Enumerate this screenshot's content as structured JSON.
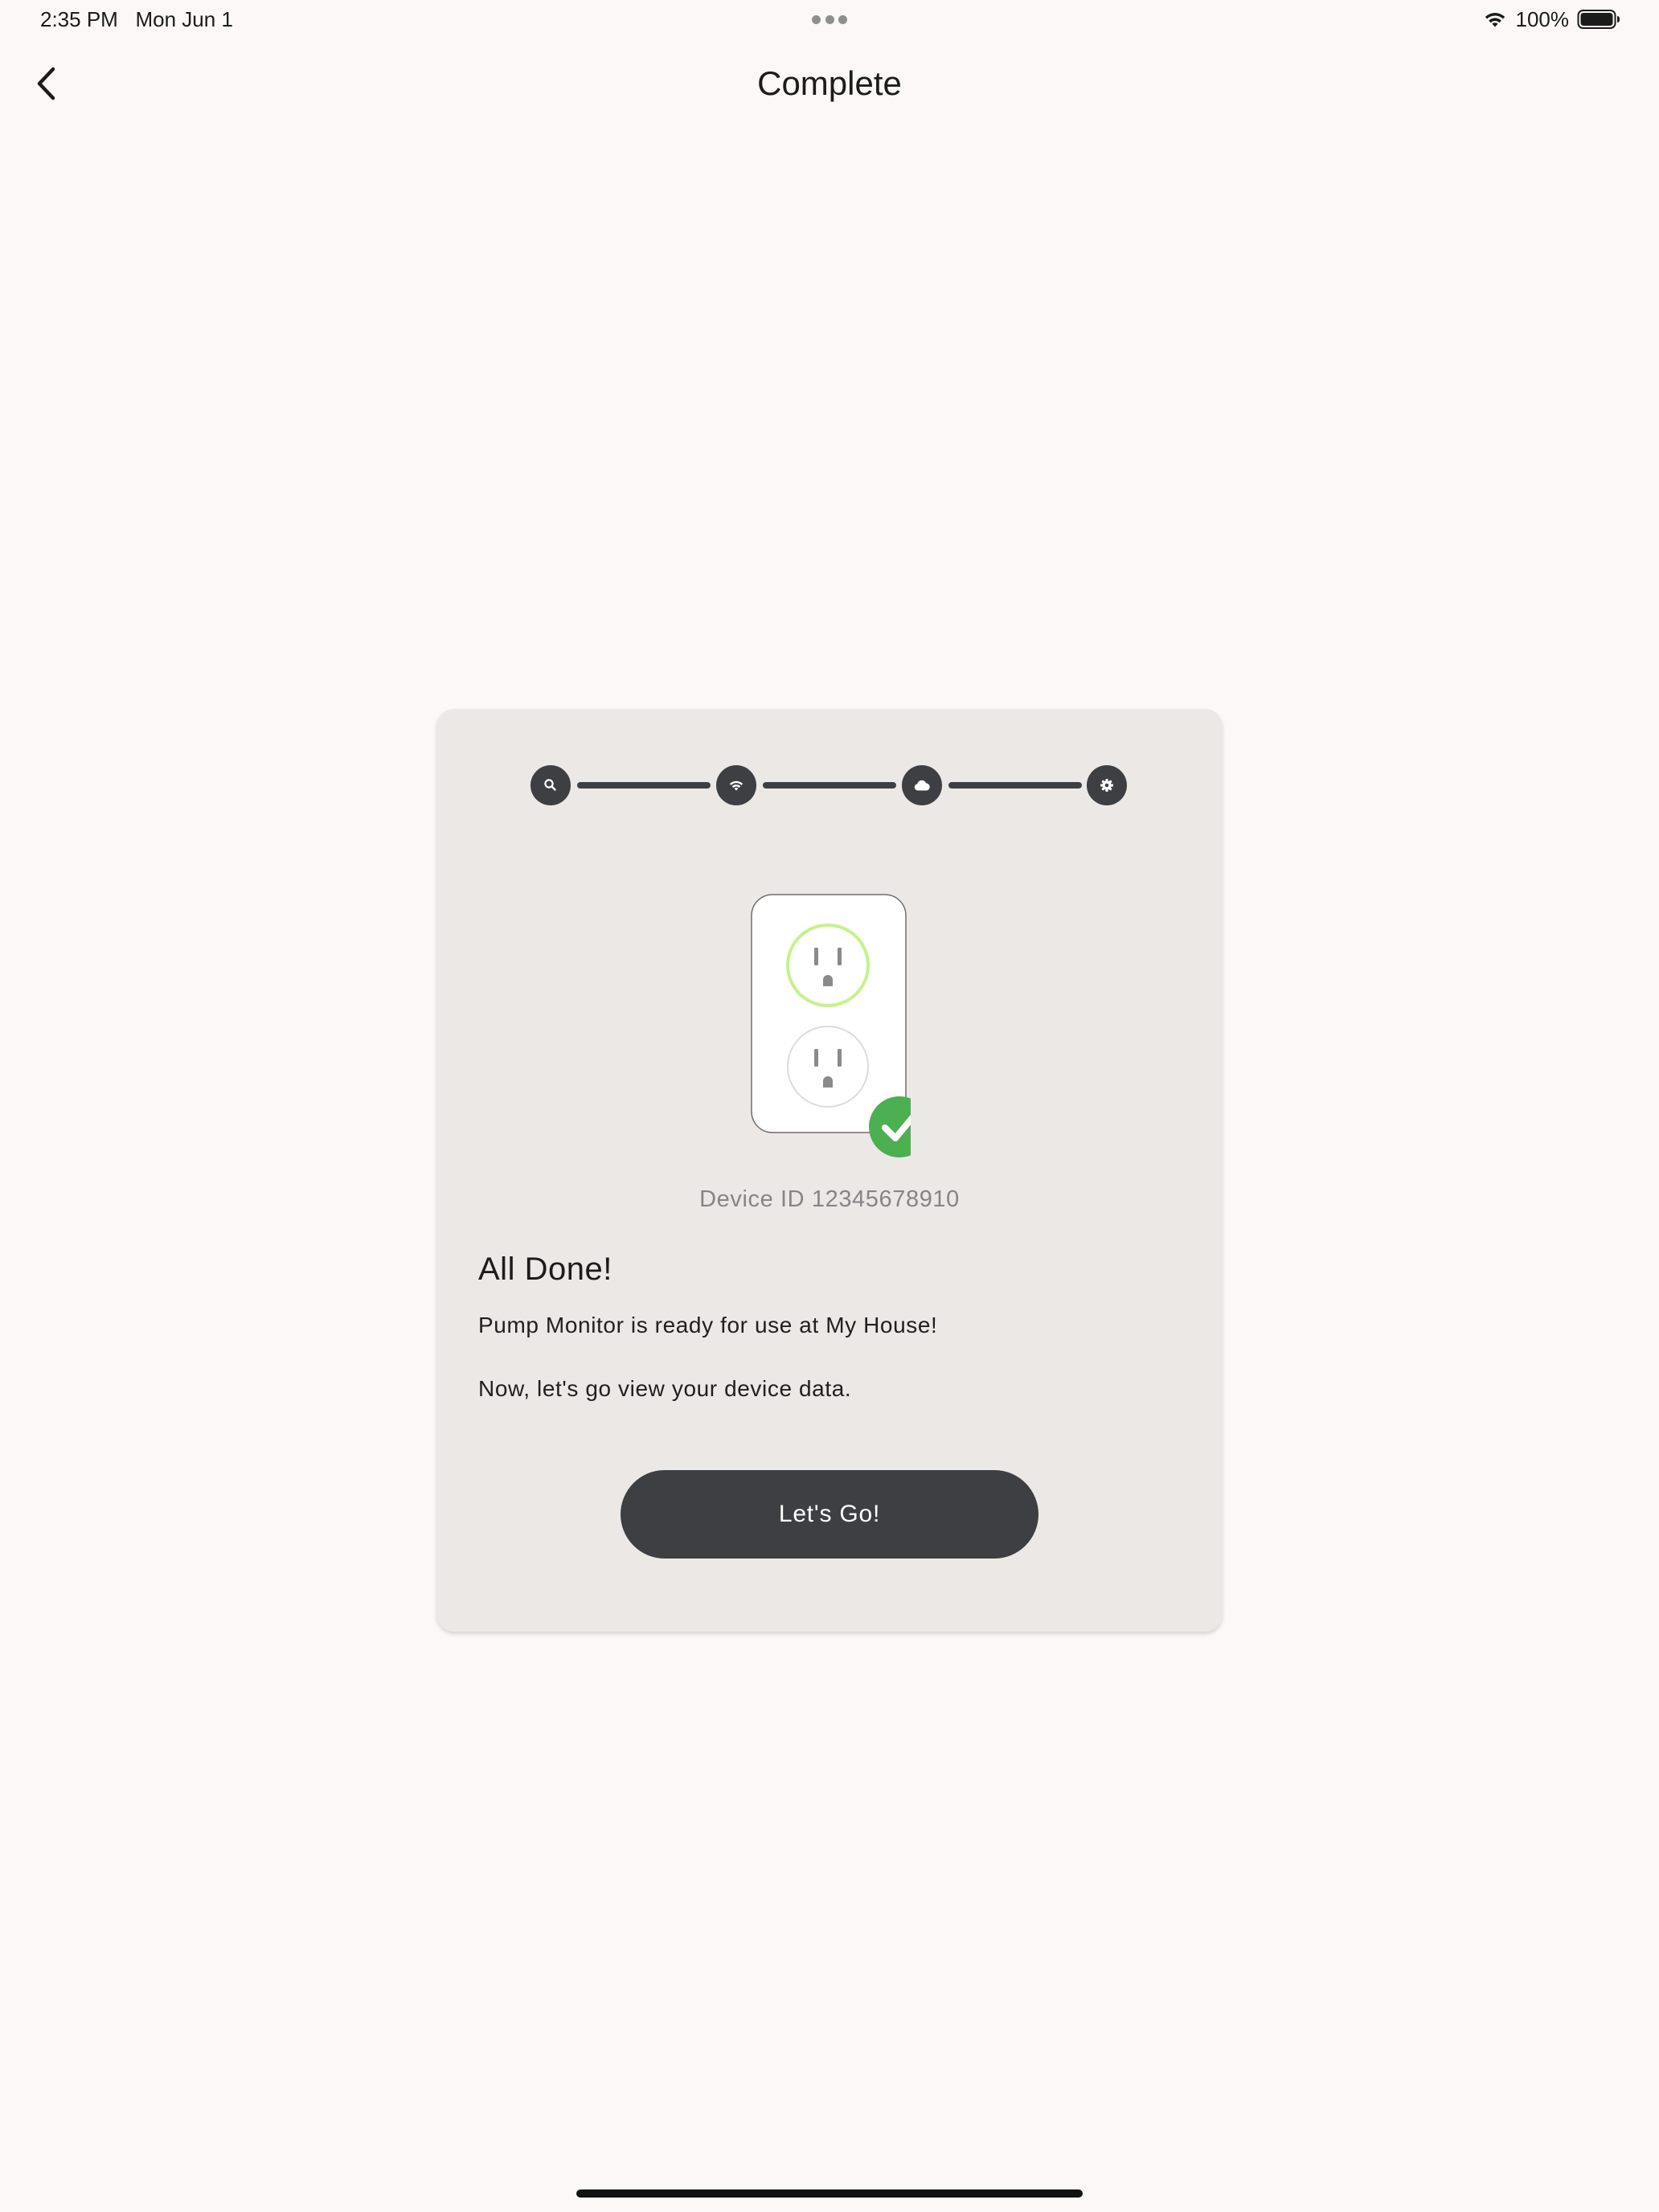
{
  "status_bar": {
    "time": "2:35 PM",
    "date": "Mon Jun 1",
    "battery": "100%"
  },
  "nav": {
    "title": "Complete"
  },
  "stepper": {
    "steps": [
      {
        "icon": "search-icon"
      },
      {
        "icon": "wifi-icon"
      },
      {
        "icon": "cloud-icon"
      },
      {
        "icon": "gear-icon"
      }
    ]
  },
  "device": {
    "id_text": "Device ID 12345678910",
    "status_icon": "check-circle-icon"
  },
  "content": {
    "title": "All Done!",
    "ready_message": "Pump Monitor is ready for use at My House!",
    "next_message": "Now, let's go view your device data."
  },
  "actions": {
    "primary_label": "Let's Go!"
  },
  "colors": {
    "background": "#fbf8f7",
    "card": "#ece8e6",
    "dark": "#3d3f42",
    "success_green": "#4caf50",
    "outlet_ring_active": "#c5f28a"
  }
}
